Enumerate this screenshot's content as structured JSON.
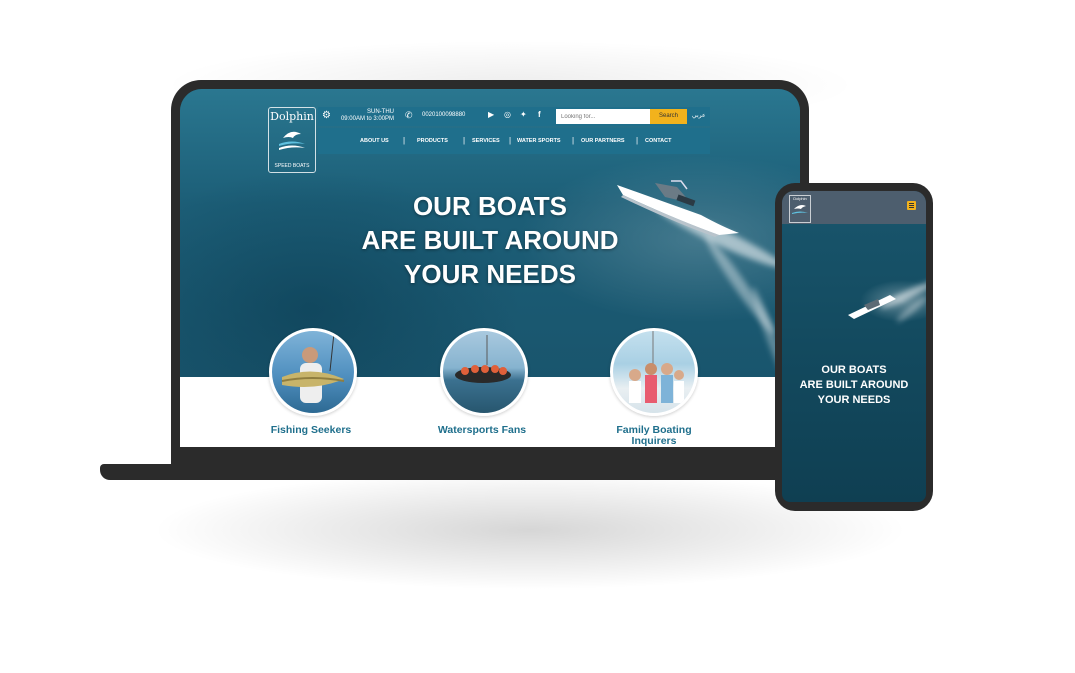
{
  "desktop": {
    "logo": {
      "name": "Dolphin",
      "tagline": "SPEED BOATS"
    },
    "topbar": {
      "days": "SUN-THU",
      "hours": "09:00AM to 3:00PM",
      "phone": "0020100098880",
      "social_icons": [
        "youtube-icon",
        "instagram-icon",
        "twitter-icon",
        "facebook-icon"
      ],
      "search_placeholder": "Looking for...",
      "search_button": "Search",
      "language": "عربي"
    },
    "nav": [
      "ABOUT US",
      "PRODUCTS",
      "SERVICES",
      "WATER SPORTS",
      "OUR PARTNERS",
      "CONTACT"
    ],
    "headline": [
      "OUR BOATS",
      "ARE BUILT AROUND",
      "YOUR NEEDS"
    ],
    "audiences": [
      {
        "label": "Fishing Seekers"
      },
      {
        "label": "Watersports Fans"
      },
      {
        "label": "Family Boating Inquirers"
      }
    ]
  },
  "mobile": {
    "logo": {
      "name": "Dolphin"
    },
    "headline": [
      "OUR BOATS",
      "ARE BUILT AROUND",
      "YOUR NEEDS"
    ]
  },
  "colors": {
    "brand_blue": "#1f6f8c",
    "accent_yellow": "#f2b21c",
    "device_frame": "#2b2b2b"
  }
}
